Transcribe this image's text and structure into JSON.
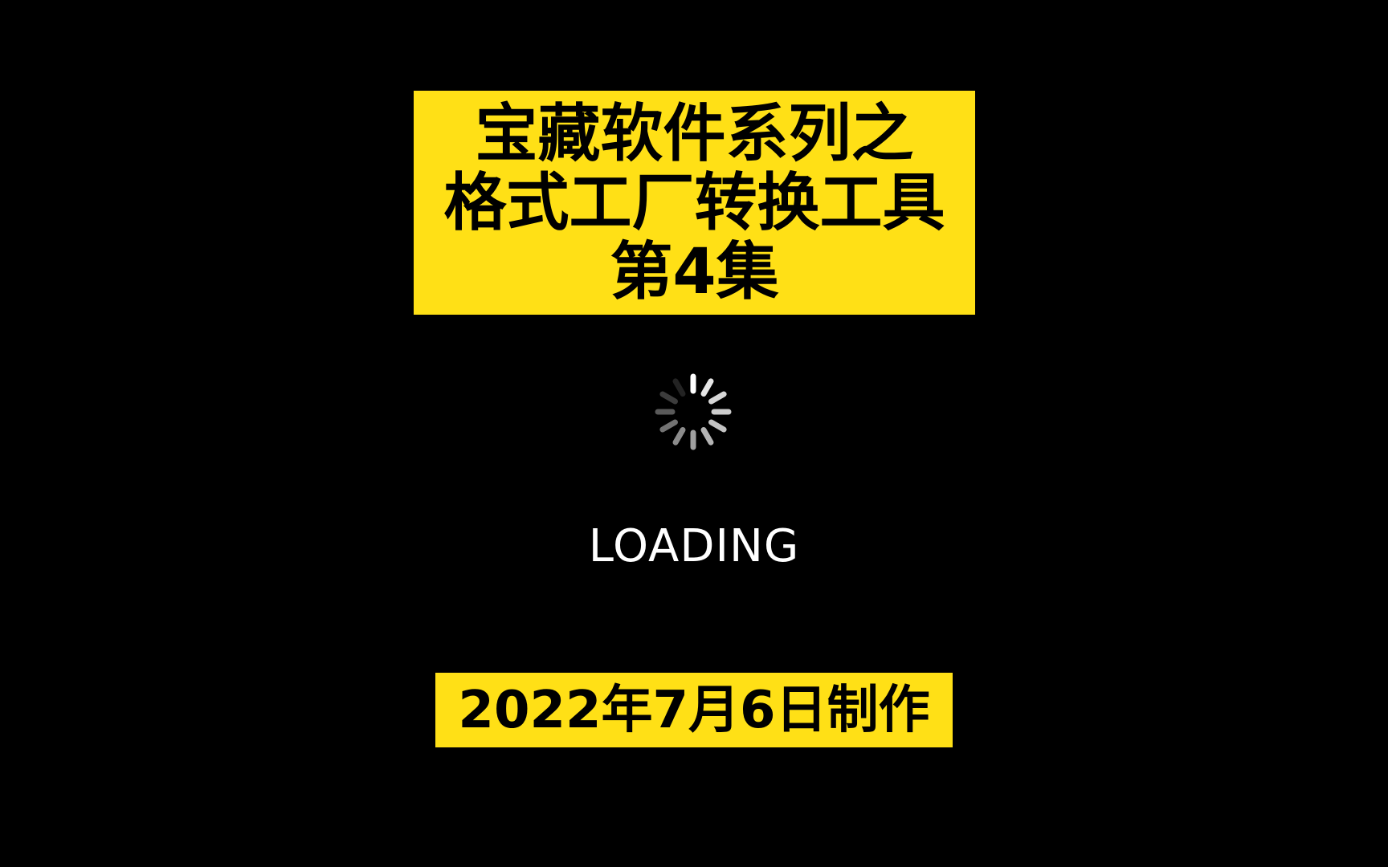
{
  "title": {
    "lines": [
      "宝藏软件系列之",
      "格式工厂转换工具",
      "第4集"
    ],
    "background_color": "#FFE016",
    "text_color": "#000000"
  },
  "loader": {
    "icon": "activity-spinner-icon",
    "text": "LOADING",
    "text_color": "#FFFFFF"
  },
  "footer": {
    "date_text": "2022年7月6日制作",
    "background_color": "#FFE016"
  },
  "background_color": "#000000"
}
